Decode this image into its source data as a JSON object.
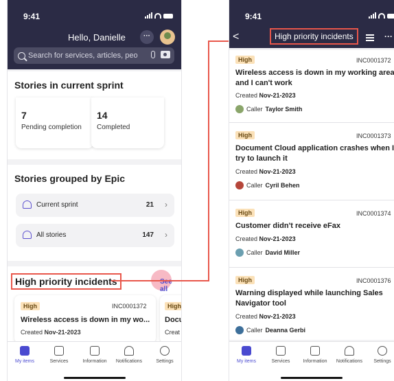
{
  "status_bar": {
    "time": "9:41"
  },
  "left": {
    "greeting": "Hello, Danielle",
    "more_label": "···",
    "search_placeholder": "Search for services, articles, people",
    "sprint": {
      "title": "Stories in current sprint",
      "stats": [
        {
          "value": "7",
          "label": "Pending completion"
        },
        {
          "value": "14",
          "label": "Completed"
        }
      ]
    },
    "epic": {
      "title": "Stories grouped by Epic",
      "rows": [
        {
          "label": "Current sprint",
          "count": "21"
        },
        {
          "label": "All stories",
          "count": "147"
        }
      ]
    },
    "incidents": {
      "title": "High priority incidents",
      "see_all": "See all",
      "card": {
        "priority": "High",
        "number": "INC0001372",
        "title": "Wireless access is down in my wo...",
        "created_prefix": "Created",
        "created_date": "Nov-21-2023"
      },
      "peek": {
        "priority": "High",
        "title": "Docu",
        "created": "Creat"
      }
    }
  },
  "right": {
    "back_label": "<",
    "title": "High priority incidents",
    "more_label": "···",
    "incidents": [
      {
        "priority": "High",
        "number": "INC0001372",
        "title": "Wireless access is down in my working area and I can't work",
        "created_prefix": "Created",
        "created_date": "Nov-21-2023",
        "caller_prefix": "Caller",
        "caller": "Taylor Smith",
        "avatar_color": "#8aa56a"
      },
      {
        "priority": "High",
        "number": "INC0001373",
        "title": "Document Cloud application crashes when I try to launch it",
        "created_prefix": "Created",
        "created_date": "Nov-21-2023",
        "caller_prefix": "Caller",
        "caller": "Cyril Behen",
        "avatar_color": "#b5463a"
      },
      {
        "priority": "High",
        "number": "INC0001374",
        "title": "Customer didn't receive eFax",
        "created_prefix": "Created",
        "created_date": "Nov-21-2023",
        "caller_prefix": "Caller",
        "caller": "David Miller",
        "avatar_color": "#6b9fb0"
      },
      {
        "priority": "High",
        "number": "INC0001376",
        "title": "Warning displayed while launching Sales Navigator tool",
        "created_prefix": "Created",
        "created_date": "Nov-21-2023",
        "caller_prefix": "Caller",
        "caller": "Deanna Gerbi",
        "avatar_color": "#3d6f9a"
      }
    ]
  },
  "tabs": [
    {
      "label": "My items",
      "icon": "briefcase-icon",
      "active": true
    },
    {
      "label": "Services",
      "icon": "edit-icon",
      "active": false
    },
    {
      "label": "Information",
      "icon": "document-icon",
      "active": false
    },
    {
      "label": "Notifications",
      "icon": "bell-icon",
      "active": false
    },
    {
      "label": "Settings",
      "icon": "gear-icon",
      "active": false
    }
  ],
  "colors": {
    "header": "#2b2b45",
    "accent": "#4a4ad0",
    "highlight": "#e8564a",
    "badge_bg": "#fbe1b8"
  }
}
